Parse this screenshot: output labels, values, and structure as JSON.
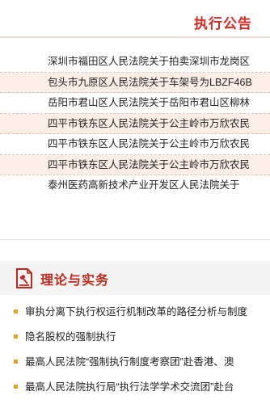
{
  "notice": {
    "title": "执行公告",
    "items": [
      "深圳市福田区人民法院关于拍卖深圳市龙岗区",
      "包头市九原区人民法院关于车架号为LBZF46B",
      "岳阳市君山区人民法院关于岳阳市君山区柳林",
      "四平市铁东区人民法院关于公主岭市万欣农民",
      "四平市铁东区人民法院关于公主岭市万欣农民",
      "四平市铁东区人民法院关于公主岭市万欣农民",
      "泰州医药高新技术产业开发区人民法院关于"
    ]
  },
  "theory": {
    "title": "理论与实务",
    "icon": "document-gavel-icon",
    "items": [
      "审执分离下执行权运行机制改革的路径分析与制度",
      "隐名股权的强制执行",
      "最高人民法院“强制执行制度考察团”赴香港、澳",
      "最高人民法院执行局“执行法学学术交流团”赴台"
    ]
  },
  "colors": {
    "accent_red": "#d42b1e",
    "row_highlight": "#fbeee6",
    "bullet": "#e9a321"
  }
}
